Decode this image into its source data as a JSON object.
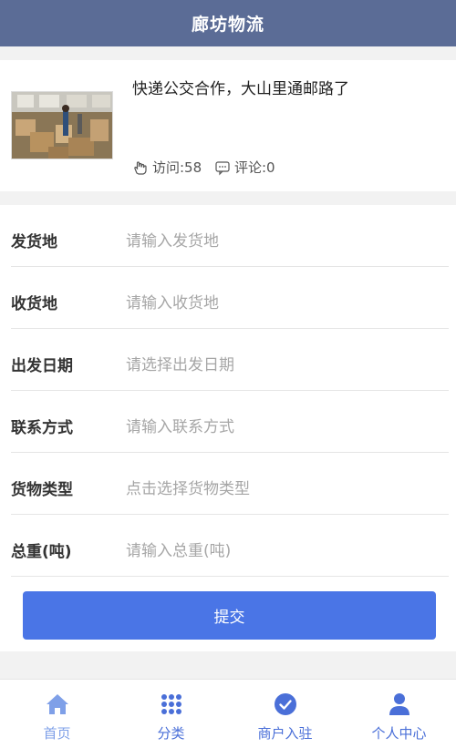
{
  "header": {
    "title": "廊坊物流"
  },
  "news": {
    "title": "快递公交合作，大山里通邮路了",
    "visits_label": "访问:58",
    "comments_label": "评论:0"
  },
  "form": {
    "fields": [
      {
        "label": "发货地",
        "placeholder": "请输入发货地",
        "value": ""
      },
      {
        "label": "收货地",
        "placeholder": "请输入收货地",
        "value": ""
      },
      {
        "label": "出发日期",
        "placeholder": "请选择出发日期",
        "value": ""
      },
      {
        "label": "联系方式",
        "placeholder": "请输入联系方式",
        "value": ""
      },
      {
        "label": "货物类型",
        "placeholder": "点击选择货物类型",
        "value": ""
      },
      {
        "label": "总重(吨)",
        "placeholder": "请输入总重(吨)",
        "value": ""
      }
    ],
    "submit_label": "提交"
  },
  "tabbar": {
    "items": [
      {
        "label": "首页",
        "icon": "home-icon",
        "active": true
      },
      {
        "label": "分类",
        "icon": "grid-icon",
        "active": false
      },
      {
        "label": "商户入驻",
        "icon": "check-circle-icon",
        "active": false
      },
      {
        "label": "个人中心",
        "icon": "user-icon",
        "active": false
      }
    ]
  },
  "colors": {
    "header_bg": "#5b6c96",
    "accent": "#4a75e6",
    "tab_active": "#7fa0e8",
    "tab_inactive": "#4a6fd8"
  }
}
